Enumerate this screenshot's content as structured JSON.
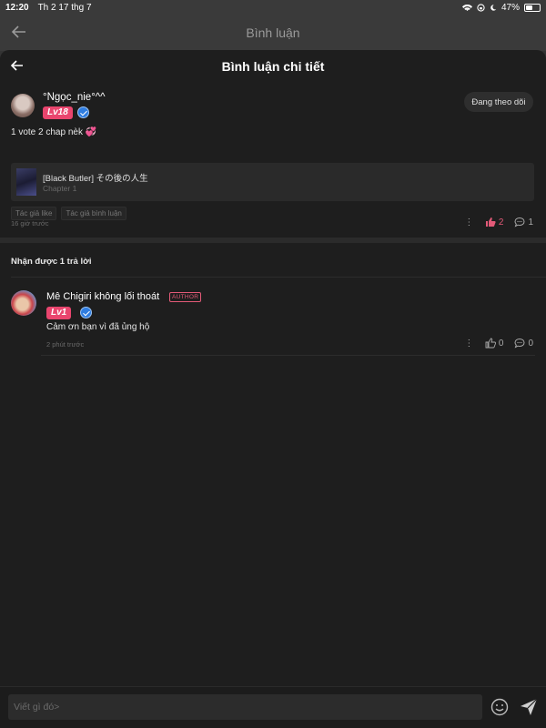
{
  "status_bar": {
    "time": "12:20",
    "date": "Th 2 17 thg 7",
    "battery": "47%",
    "battery_level": 0.47
  },
  "outer_header": {
    "title": "Bình luận"
  },
  "sheet_header": {
    "title": "Bình luận chi tiết"
  },
  "comment": {
    "username": "°Ngọc_nie°^^",
    "level": "Lv18",
    "follow_label": "Đang theo dõi",
    "text": "1 vote 2 chap nèk",
    "emoji": "💞",
    "book": {
      "title": "[Black Butler] その後の人生",
      "chapter": "Chapter 1"
    },
    "tags": [
      "Tác giả like",
      "Tác giả bình luận"
    ],
    "time": "16 giờ trước",
    "likes": "2",
    "replies": "1"
  },
  "replies_section": {
    "title": "Nhận được 1 trả lời"
  },
  "reply": {
    "username": "Mê Chigiri không lối thoát",
    "author_badge": "AUTHOR",
    "level": "Lv1",
    "text": "Cảm ơn bạn vì đã ủng hộ",
    "time": "2 phút trước",
    "likes": "0",
    "replies": "0"
  },
  "composer": {
    "placeholder": "Viết gì đó>"
  },
  "colors": {
    "accent": "#e9456e",
    "verified": "#2f7de1",
    "background": "#1e1e1e"
  }
}
